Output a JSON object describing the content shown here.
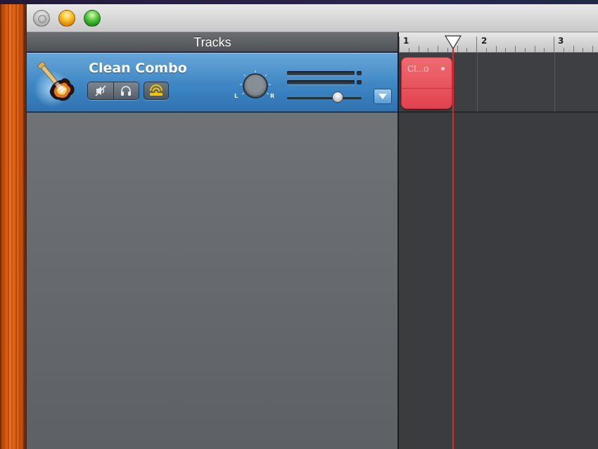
{
  "window": {
    "buttons": {
      "close": "close-button",
      "minimize": "minimize-button",
      "zoom": "zoom-button"
    }
  },
  "tracks_header": {
    "title": "Tracks"
  },
  "track": {
    "name": "Clean Combo",
    "icon": "electric-guitar-icon",
    "pan_left_label": "L",
    "pan_right_label": "R",
    "mute_icon": "mute-icon",
    "solo_icon": "headphones-icon",
    "record_icon": "record-enable-icon",
    "volume_level": 0.68
  },
  "ruler": {
    "bars": [
      "1",
      "2",
      "3"
    ]
  },
  "region": {
    "label": "Cl...o"
  },
  "colors": {
    "track_selected": "#3e86c4",
    "region": "#e0434d",
    "playhead": "#d62b2b",
    "record_active": "#f5c400"
  }
}
